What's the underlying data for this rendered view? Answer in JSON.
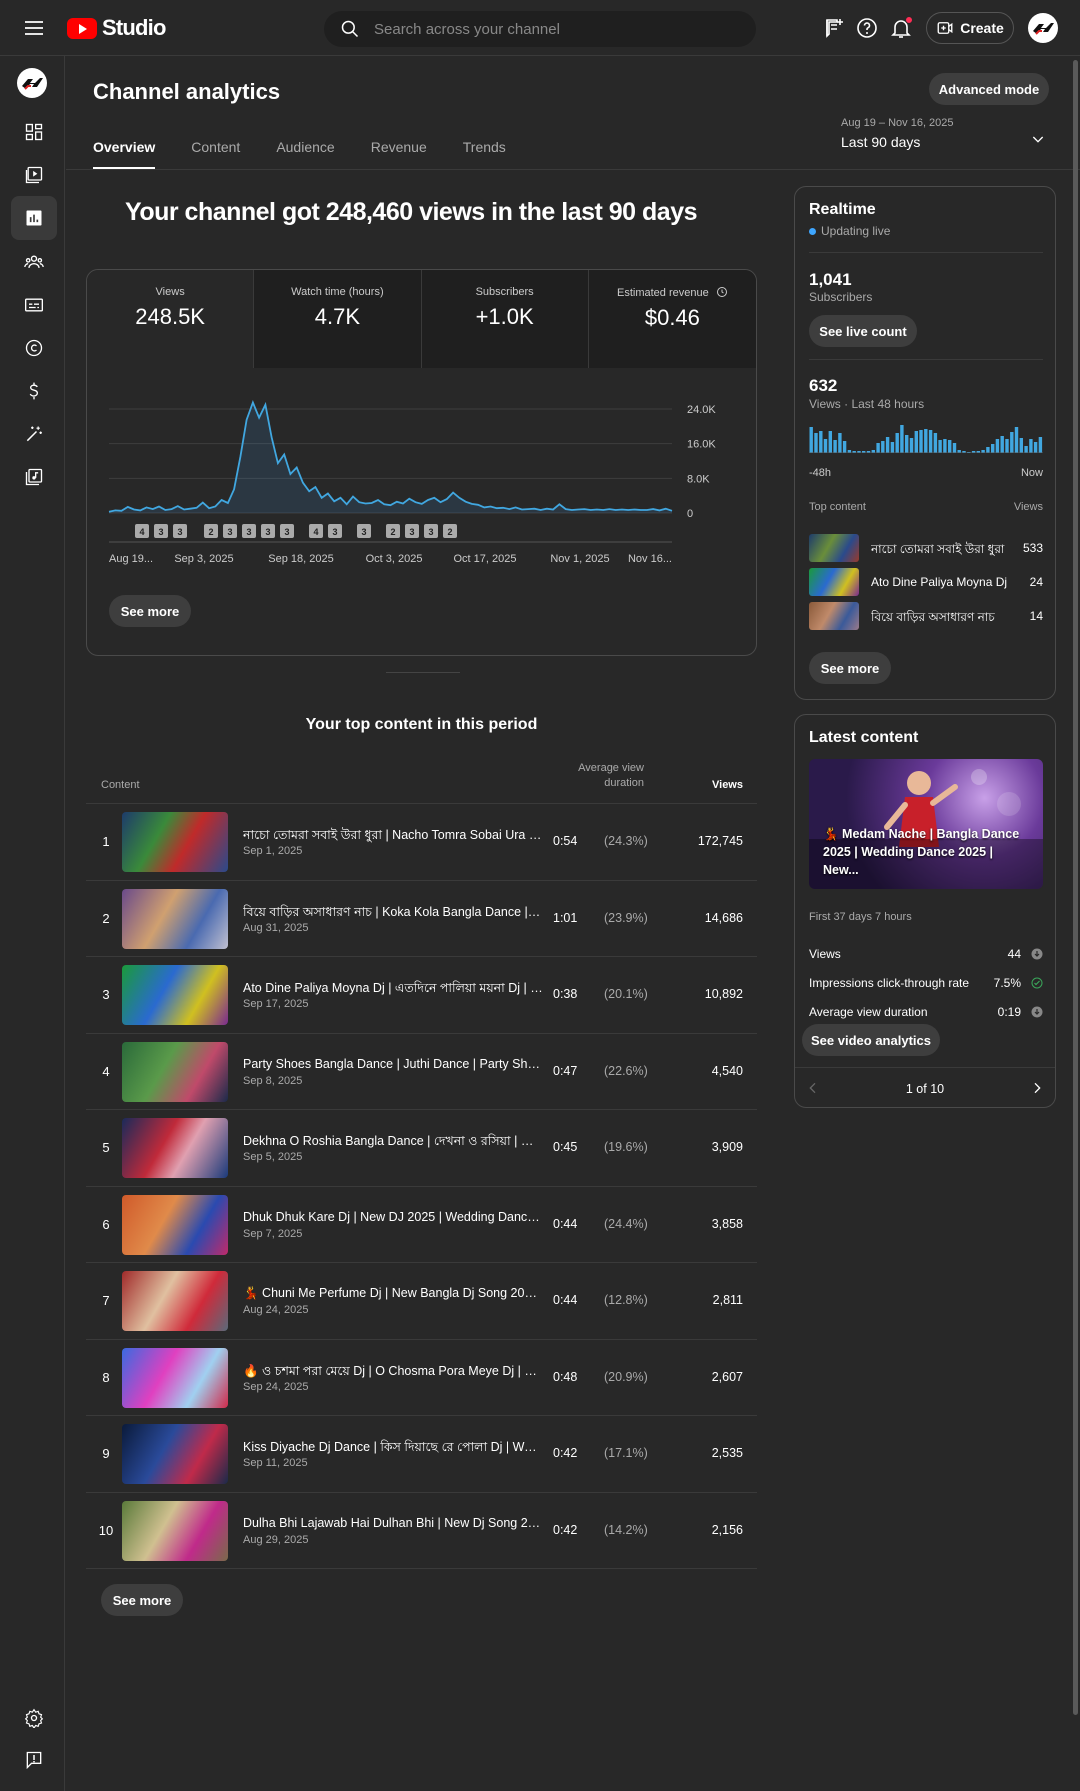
{
  "header": {
    "app_name": "Studio",
    "search_placeholder": "Search across your channel",
    "create_label": "Create"
  },
  "sidebar": {
    "items": [
      {
        "name": "dashboard"
      },
      {
        "name": "content"
      },
      {
        "name": "analytics",
        "active": true
      },
      {
        "name": "community"
      },
      {
        "name": "subtitles"
      },
      {
        "name": "copyright"
      },
      {
        "name": "earn"
      },
      {
        "name": "customization"
      },
      {
        "name": "audio-library"
      }
    ]
  },
  "page": {
    "title": "Channel analytics",
    "advanced_label": "Advanced mode",
    "tabs": [
      "Overview",
      "Content",
      "Audience",
      "Revenue",
      "Trends"
    ],
    "active_tab": "Overview",
    "date_range": {
      "dates": "Aug 19 – Nov 16, 2025",
      "label": "Last 90 days"
    },
    "headline": "Your channel got 248,460 views in the last 90 days"
  },
  "metrics": [
    {
      "label": "Views",
      "value": "248.5K"
    },
    {
      "label": "Watch time (hours)",
      "value": "4.7K"
    },
    {
      "label": "Subscribers",
      "value": "+1.0K"
    },
    {
      "label": "Estimated revenue",
      "value": "$0.46"
    }
  ],
  "chart_data": {
    "type": "area",
    "x_tick_labels": [
      "Aug 19...",
      "Sep 3, 2025",
      "Sep 18, 2025",
      "Oct 3, 2025",
      "Oct 17, 2025",
      "Nov 1, 2025",
      "Nov 16..."
    ],
    "y_tick_labels": [
      "24.0K",
      "16.0K",
      "8.0K",
      "0"
    ],
    "ylim": [
      0,
      30000
    ],
    "grid": true,
    "values": [
      300,
      600,
      500,
      1400,
      800,
      600,
      1300,
      900,
      1500,
      700,
      900,
      1600,
      800,
      1000,
      1200,
      2400,
      1100,
      1500,
      3000,
      2300,
      5500,
      13000,
      21500,
      25500,
      22000,
      25000,
      17500,
      11500,
      13500,
      9000,
      10500,
      7000,
      5000,
      6000,
      3500,
      4500,
      2700,
      3500,
      2000,
      3800,
      2500,
      2200,
      2300,
      3000,
      2000,
      1800,
      2600,
      2200,
      3300,
      2500,
      2100,
      3000,
      3500,
      2500,
      3200,
      4700,
      3500,
      2600,
      2100,
      1900,
      1300,
      1500,
      1100,
      1200,
      900,
      1300,
      800,
      900,
      1000,
      700,
      1000,
      800,
      2000,
      900,
      700,
      800,
      900,
      700,
      800,
      700,
      900,
      700,
      800,
      700,
      800,
      700,
      700,
      900,
      600,
      1000,
      500
    ],
    "upload_markers": [
      "4",
      "3",
      "3",
      "2",
      "3",
      "3",
      "3",
      "3",
      "4",
      "3",
      "3",
      "2",
      "3",
      "3",
      "2"
    ]
  },
  "overview_see_more": "See more",
  "top_content": {
    "title": "Your top content in this period",
    "headers": {
      "content": "Content",
      "avg_duration": "Average view duration",
      "views": "Views"
    },
    "rows": [
      {
        "rank": "1",
        "title": "নাচো তোমরা সবাই উরা ধুরা | Nacho Tomra Sobai Ura | New Bangla Dance",
        "date": "Sep 1, 2025",
        "duration": "0:54",
        "percent": "(24.3%)",
        "views": "172,745"
      },
      {
        "rank": "2",
        "title": "বিয়ে বাড়ির অসাধারণ নাচ | Koka Kola Bangla Dance | Koka Kola Dance",
        "date": "Aug 31, 2025",
        "duration": "1:01",
        "percent": "(23.9%)",
        "views": "14,686"
      },
      {
        "rank": "3",
        "title": "Ato Dine Paliya Moyna Dj | এতদিনে পালিয়া ময়না Dj | Bangla Dance",
        "date": "Sep 17, 2025",
        "duration": "0:38",
        "percent": "(20.1%)",
        "views": "10,892"
      },
      {
        "rank": "4",
        "title": "Party Shoes Bangla Dance | Juthi Dance | Party Shoes Dj Song",
        "date": "Sep 8, 2025",
        "duration": "0:47",
        "percent": "(22.6%)",
        "views": "4,540"
      },
      {
        "rank": "5",
        "title": "Dekhna O Roshia Bangla Dance | দেখনা ও রসিয়া | Wedding Dance",
        "date": "Sep 5, 2025",
        "duration": "0:45",
        "percent": "(19.6%)",
        "views": "3,909"
      },
      {
        "rank": "6",
        "title": "Dhuk Dhuk Kare Dj | New DJ 2025 | Wedding Dance 2025 | Bangla",
        "date": "Sep 7, 2025",
        "duration": "0:44",
        "percent": "(24.4%)",
        "views": "3,858"
      },
      {
        "rank": "7",
        "title": "💃 Chuni Me Perfume Dj | New Bangla Dj Song 2025 | Chuni Me",
        "date": "Aug 24, 2025",
        "duration": "0:44",
        "percent": "(12.8%)",
        "views": "2,811"
      },
      {
        "rank": "8",
        "title": "🔥 ও চশমা পরা মেয়ে Dj | O Chosma Pora Meye Dj | New Dance",
        "date": "Sep 24, 2025",
        "duration": "0:48",
        "percent": "(20.9%)",
        "views": "2,607"
      },
      {
        "rank": "9",
        "title": "Kiss Diyache Dj Dance | কিস দিয়াছে রে পোলা Dj | Wedding Dance",
        "date": "Sep 11, 2025",
        "duration": "0:42",
        "percent": "(17.1%)",
        "views": "2,535"
      },
      {
        "rank": "10",
        "title": "Dulha Bhi Lajawab Hai Dulhan Bhi | New Dj Song 2025 | Dance",
        "date": "Aug 29, 2025",
        "duration": "0:42",
        "percent": "(14.2%)",
        "views": "2,156"
      }
    ],
    "see_more": "See more"
  },
  "realtime": {
    "title": "Realtime",
    "status": "Updating live",
    "subscribers": "1,041",
    "subscribers_label": "Subscribers",
    "live_count_label": "See live count",
    "views": "632",
    "views_label": "Views · Last 48 hours",
    "hourly_views": [
      26,
      20,
      22,
      14,
      22,
      13,
      20,
      12,
      3,
      2,
      2,
      2,
      2,
      3,
      10,
      12,
      16,
      11,
      20,
      28,
      18,
      15,
      22,
      23,
      24,
      23,
      20,
      13,
      14,
      13,
      10,
      3,
      2,
      1,
      2,
      2,
      3,
      6,
      9,
      14,
      17,
      14,
      21,
      26,
      15,
      7,
      14,
      11,
      16
    ],
    "axis_start": "-48h",
    "axis_end": "Now",
    "top_content_label": "Top content",
    "views_col_label": "Views",
    "items": [
      {
        "title": "নাচো তোমরা সবাই উরা ধুরা",
        "views": "533"
      },
      {
        "title": "Ato Dine Paliya Moyna Dj",
        "views": "24"
      },
      {
        "title": "বিয়ে বাড়ির অসাধারণ নাচ",
        "views": "14"
      }
    ],
    "see_more": "See more"
  },
  "latest": {
    "title": "Latest content",
    "video_title": "💃 Medam Nache | Bangla Dance 2025 | Wedding Dance 2025 | New...",
    "period": "First 37 days 7 hours",
    "stats": [
      {
        "label": "Views",
        "value": "44",
        "icon": "trend-down-icon"
      },
      {
        "label": "Impressions click-through rate",
        "value": "7.5%",
        "icon": "check-circle-icon"
      },
      {
        "label": "Average view duration",
        "value": "0:19",
        "icon": "trend-down-icon"
      }
    ],
    "analytics_label": "See video analytics",
    "pager": "1 of 10"
  }
}
